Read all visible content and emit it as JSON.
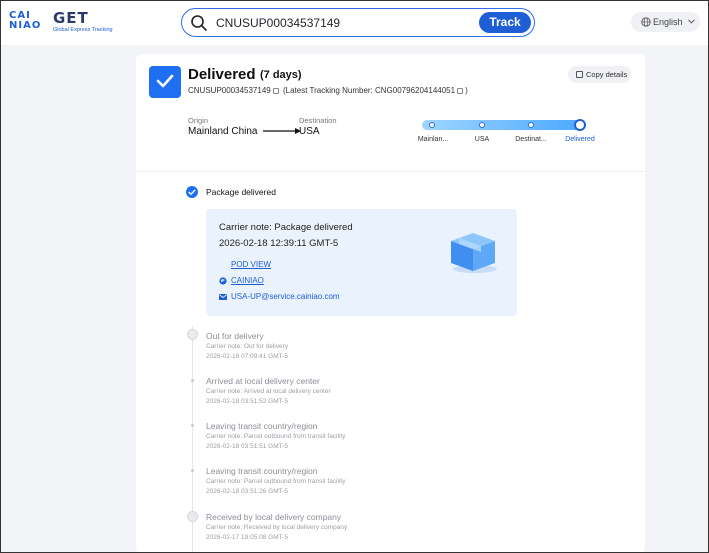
{
  "brand": {
    "logo_text_top": "CAI",
    "logo_text_bottom": "NIAO",
    "get_title": "GET",
    "get_subtitle": "Global Express Tracking",
    "accent": "#1e5fd6"
  },
  "search": {
    "value": "CNUSUP00034537149",
    "button_label": "Track",
    "icon": "search-icon"
  },
  "language": {
    "label": "English",
    "icon": "globe-icon"
  },
  "shipment": {
    "status": "Delivered",
    "duration": "(7 days)",
    "tracking_number": "CNUSUP00034537149",
    "latest_tracking": "(Latest Tracking Number: CNG00796204144051",
    "latest_tracking_close": ")",
    "copy_label": "Copy details",
    "origin_label": "Origin",
    "origin": "Mainland China",
    "destination_label": "Destination",
    "destination": "USA"
  },
  "progress_steps": [
    {
      "label": "Mainlan...",
      "active": false
    },
    {
      "label": "USA",
      "active": false
    },
    {
      "label": "Destinat...",
      "active": false
    },
    {
      "label": "Delivered",
      "active": true
    }
  ],
  "latest_event": {
    "title": "Package delivered",
    "carrier_note": "Carrier note: Package delivered",
    "time": "2026-02-18 12:39:11 GMT-5",
    "pod_link": "POD VIEW",
    "carrier_link": "CAINIAO",
    "email": "USA-UP@service.cainiao.com"
  },
  "events": [
    {
      "title": "Out for delivery",
      "note": "Carrier note: Out for delivery",
      "time": "2026-02-18 07:09:41 GMT-5",
      "icon": "truck-icon"
    },
    {
      "title": "Arrived at local delivery center",
      "note": "Carrier note: Arrived at local delivery center",
      "time": "2026-02-18 03:51:52 GMT-5",
      "icon": "dot"
    },
    {
      "title": "Leaving transit country/region",
      "note": "Carrier note: Parcel outbound from transit facility",
      "time": "2026-02-18 03:51:51 GMT-5",
      "icon": "dot"
    },
    {
      "title": "Leaving transit country/region",
      "note": "Carrier note: Parcel outbound from transit facility",
      "time": "2026-02-18 03:51:26 GMT-5",
      "icon": "dot"
    },
    {
      "title": "Received by local delivery company",
      "note": "Carrier note: Received by local delivery company",
      "time": "2026-02-17 19:05:08 GMT-5",
      "icon": "truck-icon"
    }
  ]
}
